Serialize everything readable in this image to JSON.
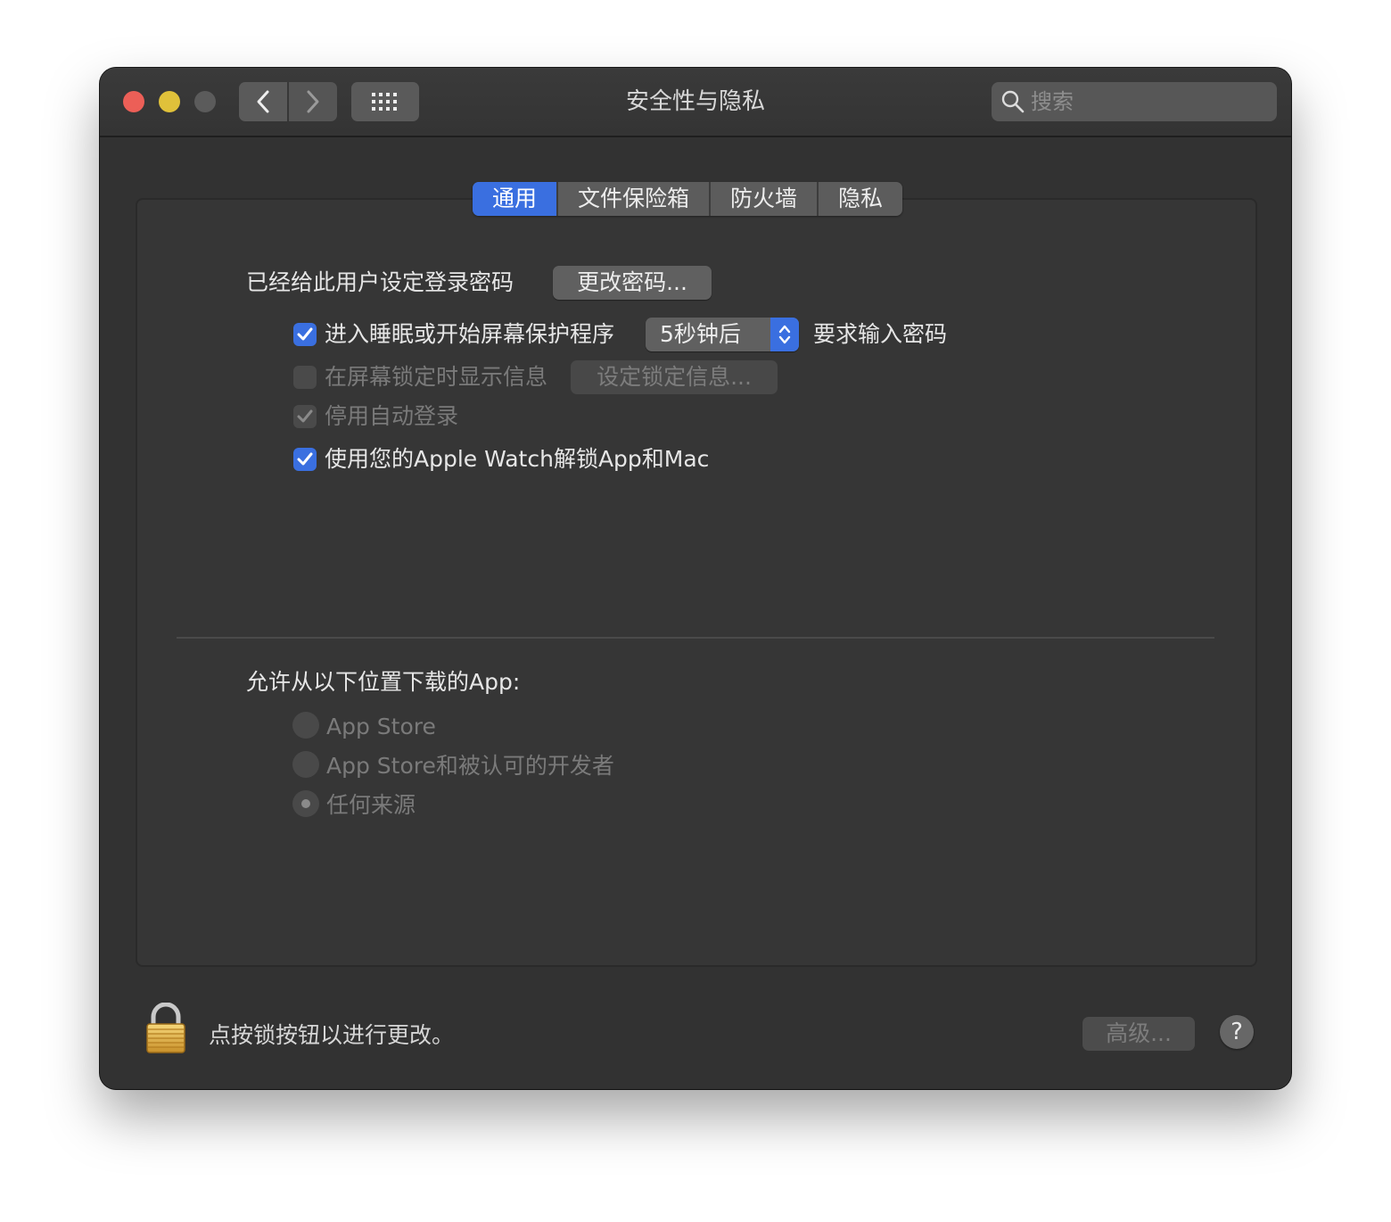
{
  "window": {
    "title": "安全性与隐私"
  },
  "search": {
    "placeholder": "搜索",
    "value": ""
  },
  "tabs": [
    {
      "label": "通用",
      "active": true
    },
    {
      "label": "文件保险箱",
      "active": false
    },
    {
      "label": "防火墙",
      "active": false
    },
    {
      "label": "隐私",
      "active": false
    }
  ],
  "general": {
    "password_status": "已经给此用户设定登录密码",
    "change_password_button": "更改密码...",
    "require_password": {
      "checked": true,
      "label": "进入睡眠或开始屏幕保护程序",
      "delay_selected": "5秒钟后",
      "suffix": "要求输入密码"
    },
    "lock_message": {
      "checked": false,
      "enabled": false,
      "label": "在屏幕锁定时显示信息",
      "button": "设定锁定信息..."
    },
    "disable_auto_login": {
      "checked": true,
      "enabled": false,
      "label": "停用自动登录"
    },
    "apple_watch_unlock": {
      "checked": true,
      "label": "使用您的Apple Watch解锁App和Mac"
    }
  },
  "downloads": {
    "heading": "允许从以下位置下载的App:",
    "options": [
      {
        "label": "App Store",
        "selected": false
      },
      {
        "label": "App Store和被认可的开发者",
        "selected": false
      },
      {
        "label": "任何来源",
        "selected": true
      }
    ]
  },
  "footer": {
    "lock_message": "点按锁按钮以进行更改。",
    "advanced_button": "高级...",
    "help_label": "?"
  },
  "colors": {
    "accent": "#3a6fe0",
    "window_bg": "#323232",
    "close": "#ec5f57",
    "minimize": "#e0c13a",
    "zoom_disabled": "#5b5b5b"
  },
  "icons": {
    "back": "chevron-left-icon",
    "forward": "chevron-right-icon",
    "show_all": "grid-icon",
    "search": "magnifier-icon",
    "lock": "padlock-icon"
  }
}
